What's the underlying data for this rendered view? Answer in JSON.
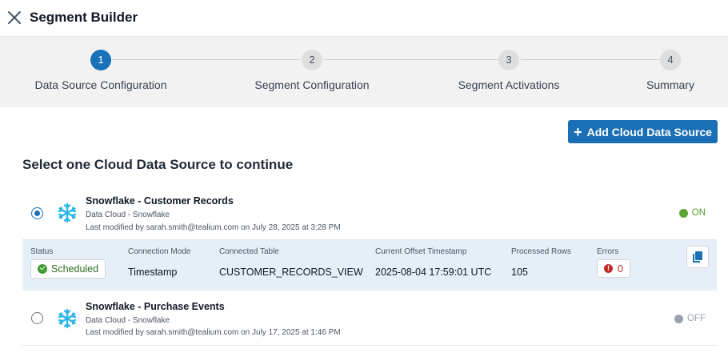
{
  "header": {
    "title": "Segment Builder",
    "close_icon": "close-icon"
  },
  "stepper": {
    "steps": [
      {
        "number": "1",
        "label": "Data Source Configuration",
        "active": true
      },
      {
        "number": "2",
        "label": "Segment Configuration",
        "active": false
      },
      {
        "number": "3",
        "label": "Segment Activations",
        "active": false
      },
      {
        "number": "4",
        "label": "Summary",
        "active": false
      }
    ]
  },
  "actions": {
    "add_cloud_data_source": "Add Cloud Data Source",
    "add_icon": "plus-icon"
  },
  "section": {
    "title": "Select one Cloud Data Source to continue"
  },
  "data_sources": [
    {
      "name": "Snowflake - Customer Records",
      "type": "Data Cloud - Snowflake",
      "modified": "Last modified by sarah.smith@tealium.com on July 28, 2025 at 3:28 PM",
      "status": "ON",
      "selected": true,
      "icon": "snowflake-icon"
    },
    {
      "name": "Snowflake - Purchase Events",
      "type": "Data Cloud - Snowflake",
      "modified": "Last modified by sarah.smith@tealium.com on July 17, 2025 at 1:46 PM",
      "status": "OFF",
      "selected": false,
      "icon": "snowflake-icon"
    }
  ],
  "details": {
    "labels": {
      "status": "Status",
      "connection_mode": "Connection Mode",
      "connected_table": "Connected Table",
      "offset_timestamp": "Current Offset Timestamp",
      "processed_rows": "Processed Rows",
      "errors": "Errors"
    },
    "values": {
      "status": "Scheduled",
      "connection_mode": "Timestamp",
      "connected_table": "CUSTOMER_RECORDS_VIEW",
      "offset_timestamp": "2025-08-04 17:59:01 UTC",
      "processed_rows": "105",
      "errors": "0"
    },
    "copy_icon": "copy-icon"
  },
  "colors": {
    "accent": "#1a6fb5",
    "on": "#5ea634",
    "off": "#9ca3af",
    "error": "#c62828",
    "detail_bg": "#e6eef7",
    "stepper_bg": "#f2f2f2"
  }
}
